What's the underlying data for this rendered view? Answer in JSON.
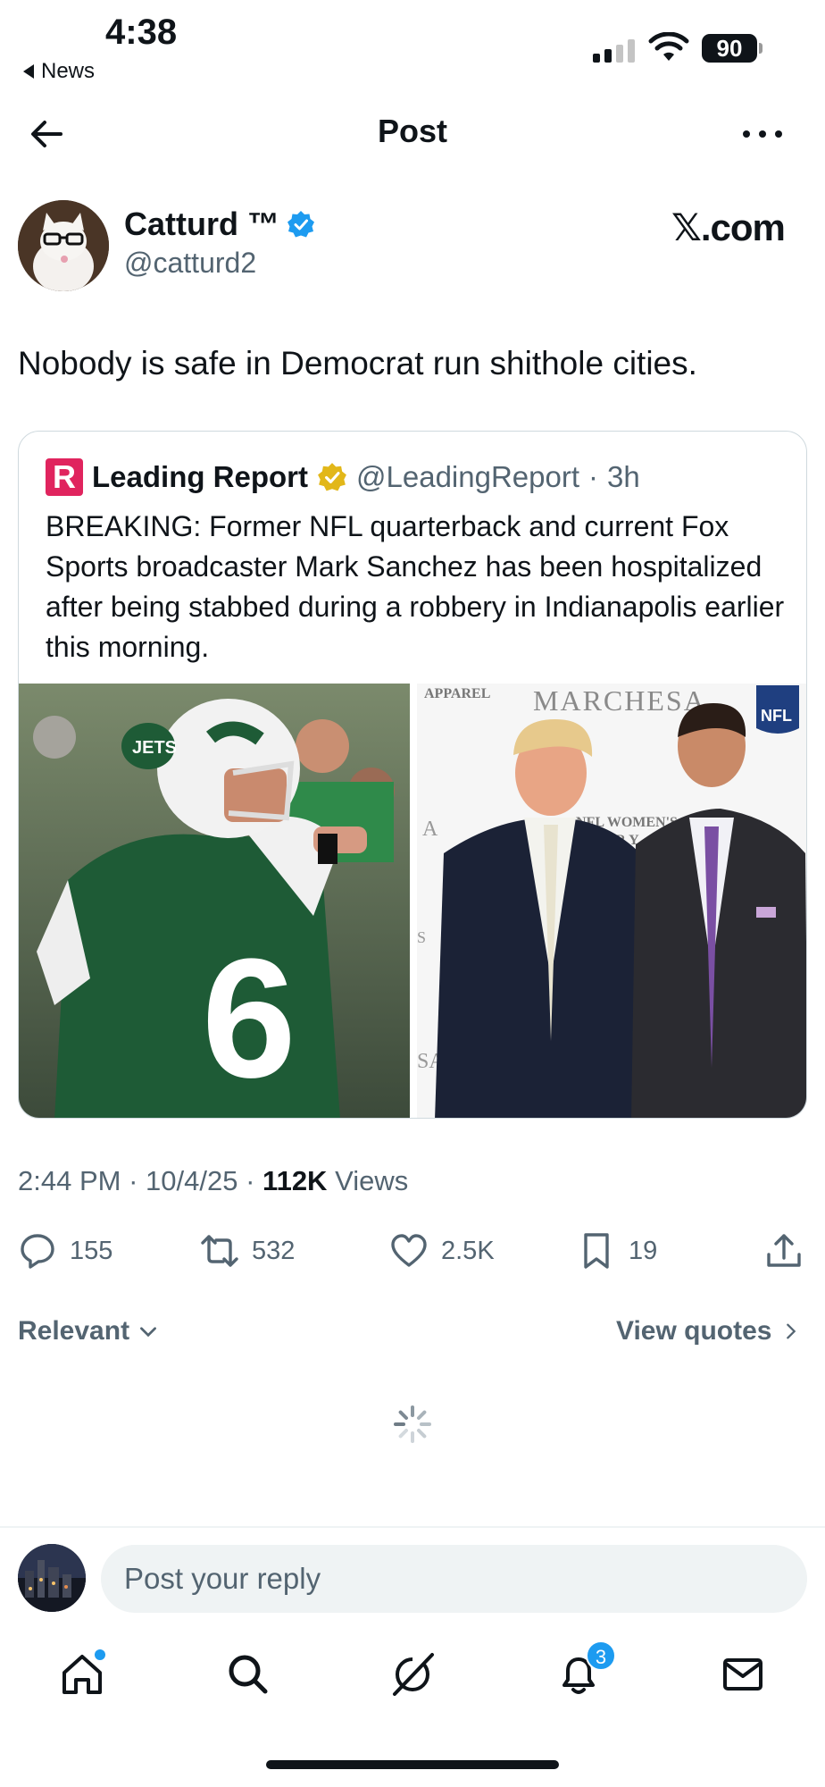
{
  "status_bar": {
    "time": "4:38",
    "back_app": "News",
    "battery": "90"
  },
  "header": {
    "title": "Post"
  },
  "author": {
    "name": "Catturd ™",
    "handle": "@catturd2",
    "source": "𝕏.com"
  },
  "post": {
    "text": "Nobody is safe in Democrat run shithole cities."
  },
  "quote": {
    "logo_letter": "R",
    "name": "Leading Report",
    "handle": "@LeadingReport",
    "separator": "·",
    "age": "3h",
    "text": "BREAKING: Former NFL quarterback and current Fox Sports broadcaster Mark Sanchez has been hospitalized after being stabbed during a robbery in Indianapolis earlier this morning.",
    "image_left_number": "6",
    "image_right_texts": [
      "APPAREL",
      "MARCHESA",
      "NFL",
      "NFL WOMEN'S",
      "FOR Y",
      "A",
      "S",
      "SA"
    ]
  },
  "timestamp": {
    "time": "2:44 PM",
    "date": "10/4/25",
    "views_count": "112K",
    "views_label": "Views",
    "sep": "·"
  },
  "actions": {
    "replies": "155",
    "reposts": "532",
    "likes": "2.5K",
    "bookmarks": "19"
  },
  "sort": {
    "relevant": "Relevant",
    "view_quotes": "View quotes"
  },
  "reply": {
    "placeholder": "Post your reply"
  },
  "tabbar": {
    "notifications_badge": "3"
  },
  "colors": {
    "accent": "#1d9bf0",
    "secondary_text": "#536471",
    "border": "#cfd9de"
  }
}
